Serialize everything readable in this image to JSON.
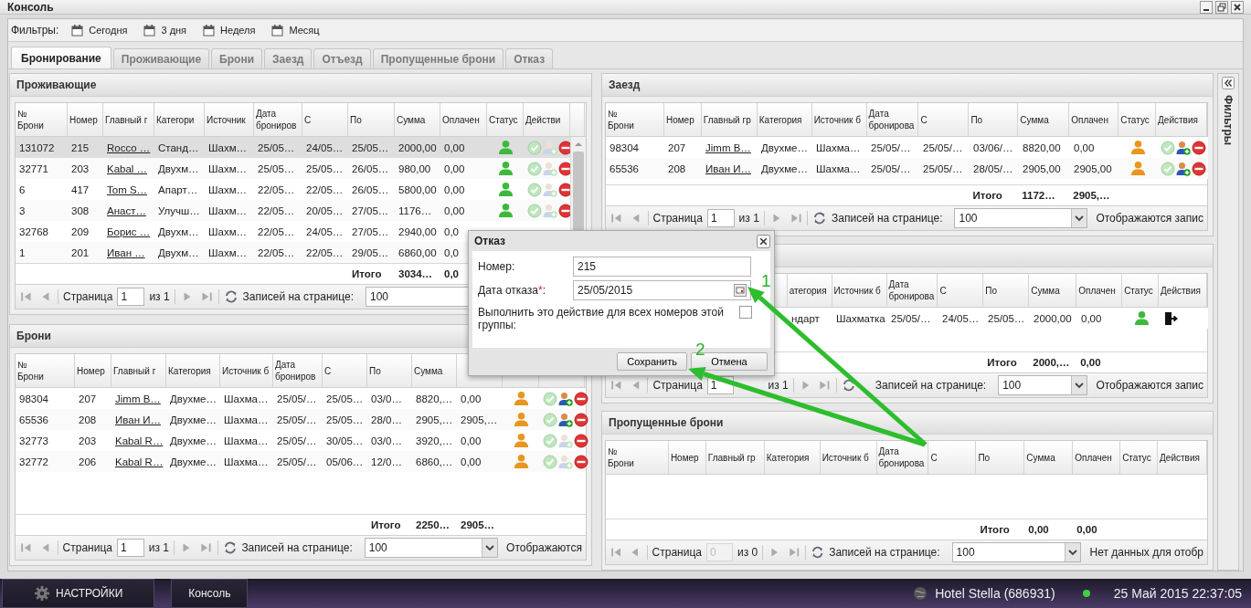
{
  "window": {
    "title": "Консоль"
  },
  "filters": {
    "label": "Фильтры:",
    "items": [
      "Сегодня",
      "3 дня",
      "Неделя",
      "Месяц"
    ]
  },
  "tabs": [
    {
      "label": "Бронирование",
      "selected": true
    },
    {
      "label": "Проживающие",
      "selected": false
    },
    {
      "label": "Брони",
      "selected": false
    },
    {
      "label": "Заезд",
      "selected": false
    },
    {
      "label": "Отъезд",
      "selected": false
    },
    {
      "label": "Пропущенные брони",
      "selected": false
    },
    {
      "label": "Отказ",
      "selected": false
    }
  ],
  "panels": [
    {
      "title": "Проживающие",
      "columns": [
        "№\nБрони",
        "Номер",
        "Главный г",
        "Категори",
        "Источник",
        "Дата\nброниров",
        "С",
        "По",
        "Сумма",
        "Оплачен",
        "Статус",
        "Действи"
      ],
      "rows": [
        {
          "selected": true,
          "cells": [
            "131072",
            "215",
            "Rocco …",
            "Станд…",
            "Шахм…",
            "25/05…",
            "24/05…",
            "25/05…",
            "2000,00",
            "0,00"
          ],
          "color": "#3cb93c",
          "kind": "manage",
          "add_enabled": false
        },
        {
          "selected": false,
          "cells": [
            "32771",
            "203",
            "Kabal …",
            "Двухм…",
            "Шахм…",
            "25/05…",
            "25/05…",
            "26/05…",
            "980,00",
            "0,00"
          ],
          "color": "#3cb93c",
          "kind": "manage",
          "add_enabled": false
        },
        {
          "selected": false,
          "cells": [
            "6",
            "417",
            "Tom S…",
            "Апарт…",
            "Шахм…",
            "22/05…",
            "22/05…",
            "26/05…",
            "5800,00",
            "0,00"
          ],
          "color": "#3cb93c",
          "kind": "manage",
          "add_enabled": false
        },
        {
          "selected": false,
          "cells": [
            "3",
            "308",
            "Анаст…",
            "Улучш…",
            "Шахм…",
            "22/05…",
            "20/05…",
            "27/05…",
            "1176…",
            "0,00"
          ],
          "color": "#3cb93c",
          "kind": "manage",
          "add_enabled": false
        },
        {
          "selected": false,
          "cells": [
            "32768",
            "209",
            "Борис …",
            "Двухм…",
            "Шахм…",
            "22/05…",
            "24/05…",
            "27/05…",
            "2940,00",
            "0,0"
          ]
        },
        {
          "selected": false,
          "cells": [
            "1",
            "201",
            "Иван …",
            "Двухм…",
            "Шахм…",
            "22/05…",
            "22/05…",
            "29/05…",
            "6860,00",
            "0,0"
          ]
        }
      ],
      "total": {
        "label": "Итого",
        "sum": "3034…",
        "paid": "0,0"
      },
      "pager": {
        "page_label": "Страница",
        "page": "1",
        "page_disabled": false,
        "of": "из 1",
        "per_page_label": "Записей на странице:",
        "per_page": "100"
      }
    },
    {
      "title": "Брони",
      "columns": [
        "№\nБрони",
        "Номер",
        "Главный г",
        "Категория",
        "Источник б",
        "Дата\nброниров",
        "С",
        "По",
        "Сумма"
      ],
      "rows": [
        {
          "selected": false,
          "cells": [
            "98304",
            "207",
            "Jimm B…",
            "Двухме…",
            "Шахма…",
            "25/05/…",
            "25/05…",
            "03/0…",
            "8820,…",
            "0,00"
          ],
          "color": "#e8961e",
          "kind": "manage",
          "add_enabled": true
        },
        {
          "selected": false,
          "cells": [
            "65536",
            "208",
            "Иван И…",
            "Двухме…",
            "Шахма…",
            "25/05/…",
            "25/05…",
            "28/0…",
            "2905,…",
            "2905,…"
          ],
          "color": "#e8961e",
          "kind": "manage",
          "add_enabled": true
        },
        {
          "selected": false,
          "cells": [
            "32773",
            "203",
            "Kabal R…",
            "Двухме…",
            "Шахма…",
            "25/05/…",
            "30/05…",
            "03/0…",
            "3920,…",
            "0,00"
          ],
          "color": "#e8961e",
          "kind": "manage",
          "add_enabled": false
        },
        {
          "selected": false,
          "cells": [
            "32772",
            "206",
            "Kabal R…",
            "Двухме…",
            "Шахма…",
            "25/05/…",
            "05/06…",
            "12/0…",
            "6860,…",
            "0,00"
          ],
          "color": "#e8961e",
          "kind": "manage",
          "add_enabled": false
        }
      ],
      "total": {
        "label": "Итого",
        "sum": "2250…",
        "paid": "2905…"
      },
      "pager": {
        "page_label": "Страница",
        "page": "1",
        "page_disabled": false,
        "of": "из 1",
        "per_page_label": "Записей на странице:",
        "per_page": "100",
        "info": "Отображаются"
      }
    },
    {
      "title": "Заезд",
      "columns": [
        "№\nБрони",
        "Номер",
        "Главный гр",
        "Категория",
        "Источник б",
        "Дата\nбронирова",
        "С",
        "По",
        "Сумма",
        "Оплачен",
        "Статус",
        "Действия"
      ],
      "rows": [
        {
          "selected": false,
          "cells": [
            "98304",
            "207",
            "Jimm B…",
            "Двухме…",
            "Шахма…",
            "25/05/…",
            "25/05/…",
            "03/06/…",
            "8820,00",
            "0,00"
          ],
          "color": "#e8961e",
          "kind": "manage",
          "add_enabled": true
        },
        {
          "selected": false,
          "cells": [
            "65536",
            "208",
            "Иван И…",
            "Двухме…",
            "Шахма…",
            "25/05/…",
            "25/05/…",
            "28/05/…",
            "2905,00",
            "2905,00"
          ],
          "color": "#e8961e",
          "kind": "manage",
          "add_enabled": true
        }
      ],
      "total": {
        "label": "Итого",
        "sum": "1172…",
        "paid": "2905,…"
      },
      "pager": {
        "page_label": "Страница",
        "page": "1",
        "page_disabled": false,
        "of": "из 1",
        "per_page_label": "Записей на странице:",
        "per_page": "100",
        "info": "Отображаются запис"
      }
    },
    {
      "columns": [
        "атегория",
        "Источник б",
        "Дата\nбронирова",
        "С",
        "По",
        "Сумма",
        "Оплачен",
        "Статус",
        "Действия"
      ],
      "rows": [
        {
          "selected": false,
          "cells": [
            "ндарт",
            "Шахматка",
            "25/05/…",
            "24/05…",
            "25/05…",
            "2000,00",
            "0,00"
          ],
          "color": "#3cb93c",
          "kind": "checkout"
        }
      ],
      "total": {
        "label": "Итого",
        "sum": "2000,…",
        "paid": "0,00"
      },
      "pager": {
        "page_label": "Страница",
        "page": "1",
        "page_disabled": false,
        "of": "из 1",
        "per_page_label": "Записей на странице:",
        "per_page": "100",
        "info": "Отображаются запис"
      }
    },
    {
      "title": "Пропущенные брони",
      "columns": [
        "№\nБрони",
        "Номер",
        "Главный гр",
        "Категория",
        "Источник б",
        "Дата\nбронирова",
        "С",
        "По",
        "Сумма",
        "Оплачен",
        "Статус",
        "Действия"
      ],
      "total": {
        "label": "Итого",
        "sum": "0,00",
        "paid": "0,00"
      },
      "pager": {
        "page_label": "Страница",
        "page": "0",
        "page_disabled": true,
        "of": "из 0",
        "per_page_label": "Записей на странице:",
        "per_page": "100",
        "info": "Нет данных для отобр"
      }
    }
  ],
  "side_panel": {
    "title": "Фильтры"
  },
  "dialog": {
    "title": "Отказ",
    "fields": [
      {
        "kind": "text",
        "label": "Номер:",
        "value": "215"
      },
      {
        "kind": "date",
        "label": "Дата отказа",
        "required_mark": "*",
        "label_end": ":",
        "value": "25/05/2015"
      },
      {
        "kind": "checkbox",
        "label": "Выполнить это действие для всех номеров этой группы:",
        "checked": false
      }
    ],
    "buttons": [
      "Сохранить",
      "Отмена"
    ]
  },
  "annotations": [
    "1",
    "2"
  ],
  "taskbar": {
    "buttons": [
      {
        "kind": "settings",
        "label": "НАСТРОЙКИ"
      },
      {
        "kind": "window",
        "label": "Консоль"
      }
    ],
    "hotel": "Hotel Stella (686931)",
    "datetime": "25 Май 2015 22:37:05"
  }
}
